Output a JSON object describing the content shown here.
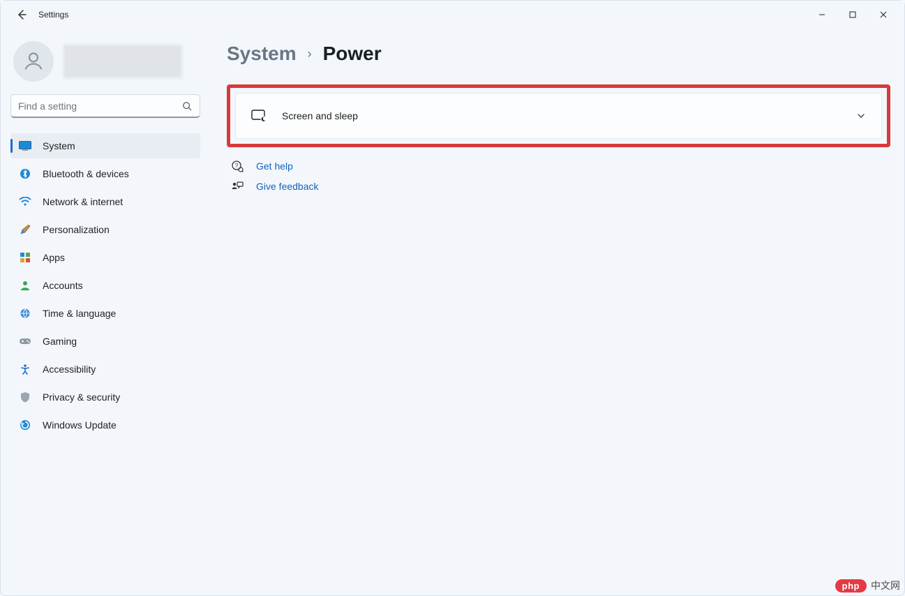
{
  "window": {
    "title": "Settings"
  },
  "search": {
    "placeholder": "Find a setting"
  },
  "nav": {
    "items": [
      {
        "id": "system",
        "label": "System",
        "active": true
      },
      {
        "id": "bluetooth",
        "label": "Bluetooth & devices",
        "active": false
      },
      {
        "id": "network",
        "label": "Network & internet",
        "active": false
      },
      {
        "id": "personalization",
        "label": "Personalization",
        "active": false
      },
      {
        "id": "apps",
        "label": "Apps",
        "active": false
      },
      {
        "id": "accounts",
        "label": "Accounts",
        "active": false
      },
      {
        "id": "time",
        "label": "Time & language",
        "active": false
      },
      {
        "id": "gaming",
        "label": "Gaming",
        "active": false
      },
      {
        "id": "accessibility",
        "label": "Accessibility",
        "active": false
      },
      {
        "id": "privacy",
        "label": "Privacy & security",
        "active": false
      },
      {
        "id": "update",
        "label": "Windows Update",
        "active": false
      }
    ]
  },
  "breadcrumb": {
    "parent": "System",
    "current": "Power"
  },
  "panel": {
    "screen_sleep": "Screen and sleep"
  },
  "help": {
    "get_help": "Get help",
    "give_feedback": "Give feedback"
  },
  "watermark": {
    "pill": "php",
    "text": "中文网"
  }
}
